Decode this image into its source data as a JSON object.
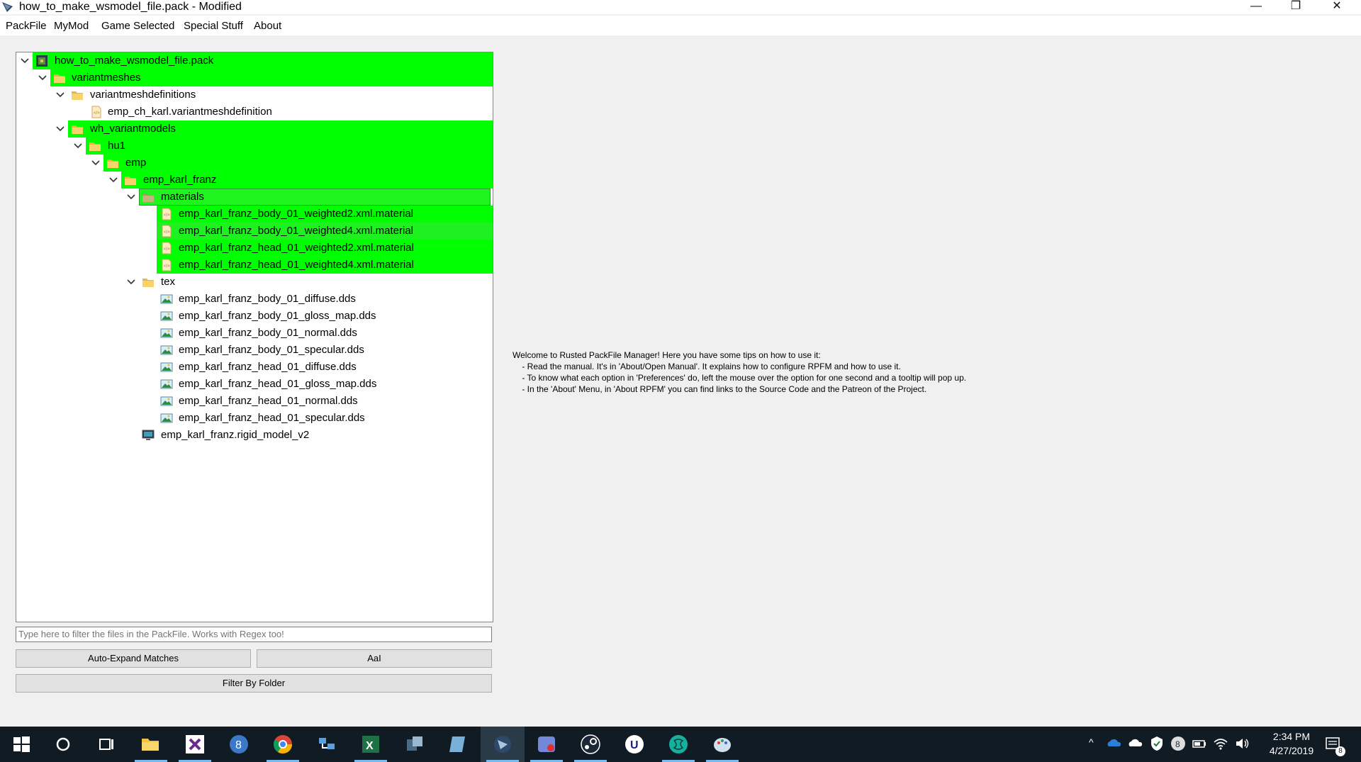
{
  "window": {
    "title": "how_to_make_wsmodel_file.pack - Modified",
    "minimize": "—",
    "restore": "❐",
    "close": "✕"
  },
  "menu": [
    "PackFile",
    "MyMod",
    "Game Selected",
    "Special Stuff",
    "About"
  ],
  "tree": {
    "rows": [
      {
        "label": "how_to_make_wsmodel_file.pack",
        "icon": "pack-icon",
        "expanded": true,
        "highlight": "green"
      },
      {
        "label": "variantmeshes",
        "icon": "folder-icon",
        "expanded": true,
        "highlight": "green"
      },
      {
        "label": "variantmeshdefinitions",
        "icon": "folder-icon",
        "expanded": true,
        "highlight": "none"
      },
      {
        "label": "emp_ch_karl.variantmeshdefinition",
        "icon": "text-file-icon",
        "highlight": "none"
      },
      {
        "label": "wh_variantmodels",
        "icon": "folder-icon",
        "expanded": true,
        "highlight": "green"
      },
      {
        "label": "hu1",
        "icon": "folder-icon",
        "expanded": true,
        "highlight": "green"
      },
      {
        "label": "emp",
        "icon": "folder-icon",
        "expanded": true,
        "highlight": "green"
      },
      {
        "label": "emp_karl_franz",
        "icon": "folder-icon",
        "expanded": true,
        "highlight": "green"
      },
      {
        "label": "materials",
        "icon": "folder-icon",
        "expanded": true,
        "highlight": "selected"
      },
      {
        "label": "emp_karl_franz_body_01_weighted2.xml.material",
        "icon": "text-file-icon",
        "highlight": "green"
      },
      {
        "label": "emp_karl_franz_body_01_weighted4.xml.material",
        "icon": "text-file-icon",
        "highlight": "hover"
      },
      {
        "label": "emp_karl_franz_head_01_weighted2.xml.material",
        "icon": "text-file-icon",
        "highlight": "green"
      },
      {
        "label": "emp_karl_franz_head_01_weighted4.xml.material",
        "icon": "text-file-icon",
        "highlight": "green"
      },
      {
        "label": "tex",
        "icon": "folder-icon",
        "expanded": true,
        "highlight": "none"
      },
      {
        "label": "emp_karl_franz_body_01_diffuse.dds",
        "icon": "image-file-icon",
        "highlight": "none"
      },
      {
        "label": "emp_karl_franz_body_01_gloss_map.dds",
        "icon": "image-file-icon",
        "highlight": "none"
      },
      {
        "label": "emp_karl_franz_body_01_normal.dds",
        "icon": "image-file-icon",
        "highlight": "none"
      },
      {
        "label": "emp_karl_franz_body_01_specular.dds",
        "icon": "image-file-icon",
        "highlight": "none"
      },
      {
        "label": "emp_karl_franz_head_01_diffuse.dds",
        "icon": "image-file-icon",
        "highlight": "none"
      },
      {
        "label": "emp_karl_franz_head_01_gloss_map.dds",
        "icon": "image-file-icon",
        "highlight": "none"
      },
      {
        "label": "emp_karl_franz_head_01_normal.dds",
        "icon": "image-file-icon",
        "highlight": "none"
      },
      {
        "label": "emp_karl_franz_head_01_specular.dds",
        "icon": "image-file-icon",
        "highlight": "none"
      },
      {
        "label": "emp_karl_franz.rigid_model_v2",
        "icon": "model-file-icon",
        "highlight": "none"
      }
    ]
  },
  "filter": {
    "placeholder": "Type here to filter the files in the PackFile. Works with Regex too!",
    "auto_expand_label": "Auto-Expand Matches",
    "case_label": "AaI",
    "by_folder_label": "Filter By Folder"
  },
  "welcome": {
    "line1": "Welcome to Rusted PackFile Manager! Here you have some tips on how to use it:",
    "line2": "    - Read the manual. It's in 'About/Open Manual'. It explains how to configure RPFM and how to use it.",
    "line3": "    - To know what each option in 'Preferences' do, left the mouse over the option for one second and a tooltip will pop up.",
    "line4": "    - In the 'About' Menu, in 'About RPFM' you can find links to the Source Code and the Patreon of the Project."
  },
  "taskbar": {
    "time": "2:34 PM",
    "date": "4/27/2019",
    "notification_count": "8"
  },
  "colors": {
    "highlight": "#00ff00",
    "taskbar": "#101b24",
    "accent": "#76b9ed"
  }
}
